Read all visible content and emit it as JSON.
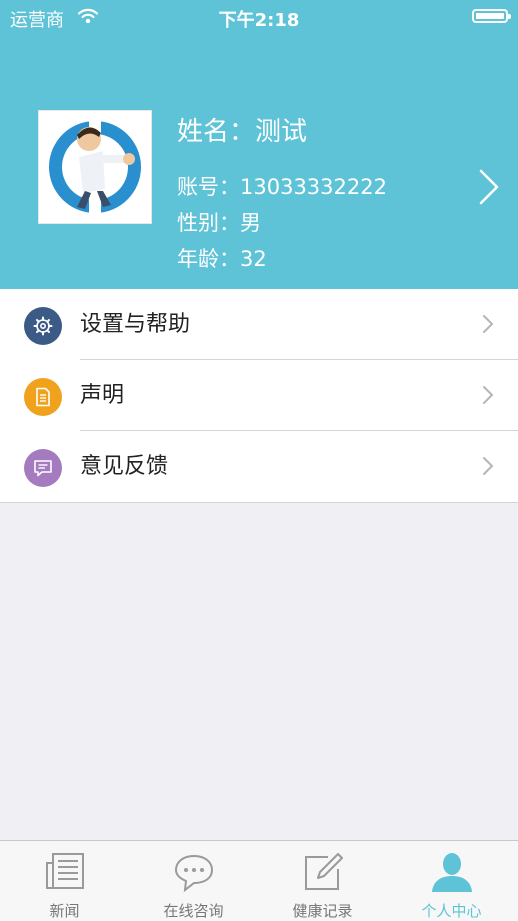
{
  "status_bar": {
    "carrier": "运营商",
    "time": "下午2:18"
  },
  "profile": {
    "name_label": "姓名：",
    "name": "测试",
    "account_label": "账号：",
    "account": "13033332222",
    "gender_label": "性别：",
    "gender": "男",
    "age_label": "年龄：",
    "age": "32"
  },
  "menu": [
    {
      "label": "设置与帮助",
      "icon": "gear-icon",
      "color": "#3b5a86"
    },
    {
      "label": "声明",
      "icon": "document-icon",
      "color": "#f0a21c"
    },
    {
      "label": "意见反馈",
      "icon": "feedback-icon",
      "color": "#a57bc0"
    }
  ],
  "tabs": [
    {
      "label": "新闻",
      "icon": "news-icon"
    },
    {
      "label": "在线咨询",
      "icon": "chat-icon"
    },
    {
      "label": "健康记录",
      "icon": "edit-icon"
    },
    {
      "label": "个人中心",
      "icon": "person-icon",
      "active": true
    }
  ],
  "colors": {
    "accent": "#5ec3d6",
    "background": "#efeff4"
  }
}
